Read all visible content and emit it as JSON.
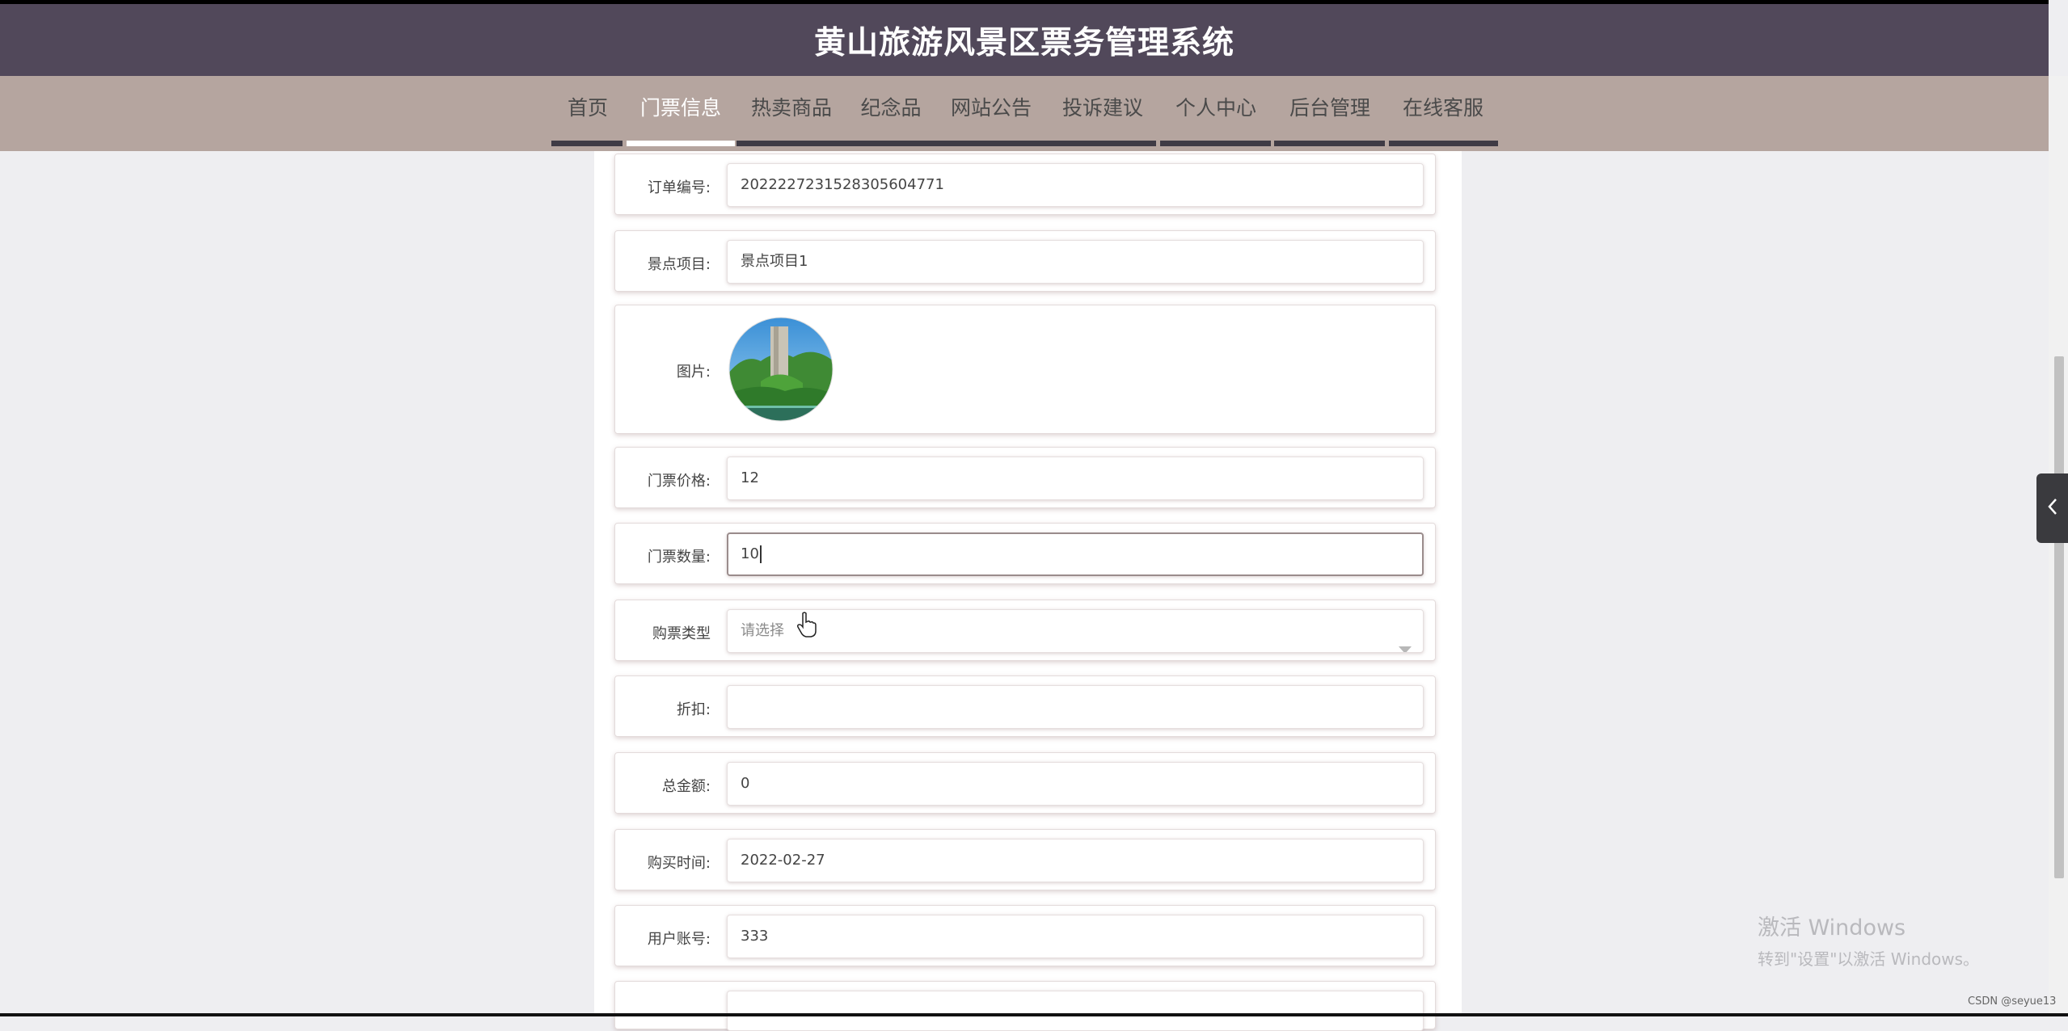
{
  "header": {
    "title": "黄山旅游风景区票务管理系统"
  },
  "nav": {
    "items": [
      {
        "label": "首页"
      },
      {
        "label": "门票信息",
        "active": true
      },
      {
        "label": "热卖商品"
      },
      {
        "label": "纪念品"
      },
      {
        "label": "网站公告"
      },
      {
        "label": "投诉建议"
      },
      {
        "label": "个人中心"
      },
      {
        "label": "后台管理"
      },
      {
        "label": "在线客服"
      }
    ]
  },
  "form": {
    "order_no": {
      "label": "订单编号:",
      "value": "2022227231528305604771"
    },
    "scenic_item": {
      "label": "景点项目:",
      "value": "景点项目1"
    },
    "image": {
      "label": "图片:"
    },
    "ticket_price": {
      "label": "门票价格:",
      "value": "12"
    },
    "ticket_qty": {
      "label": "门票数量:",
      "value": "10"
    },
    "purchase_type": {
      "label": "购票类型",
      "placeholder": "请选择"
    },
    "discount": {
      "label": "折扣:",
      "value": ""
    },
    "total_amount": {
      "label": "总金额:",
      "value": "0"
    },
    "purchase_time": {
      "label": "购买时间:",
      "value": "2022-02-27"
    },
    "user_account": {
      "label": "用户账号:",
      "value": "333"
    }
  },
  "watermark": {
    "line1": "激活 Windows",
    "line2": "转到\"设置\"以激活 Windows。"
  },
  "footer": {
    "credit": "CSDN @seyue13"
  },
  "colors": {
    "header_bg": "#51485a",
    "nav_bg": "#b5a59f",
    "nav_underline": "#3f3b45"
  }
}
